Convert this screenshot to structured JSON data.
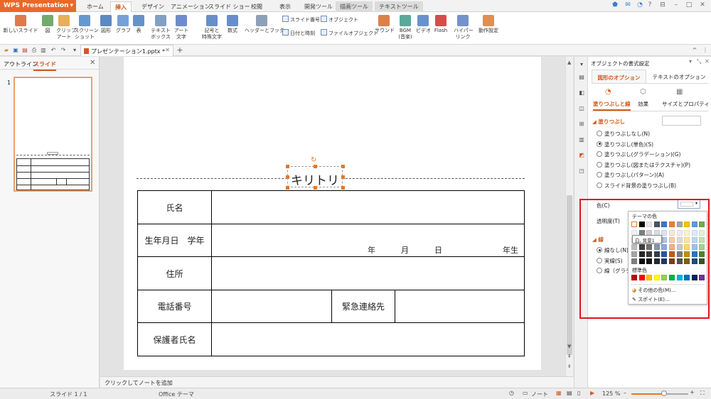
{
  "app": {
    "name": "WPS Presentation",
    "menu_arrow": "▾"
  },
  "menu_tabs": [
    "ホーム",
    "挿入",
    "デザイン",
    "アニメーション",
    "スライド ショー",
    "校閲",
    "表示",
    "開発ツール",
    "描画ツール",
    "テキストツール"
  ],
  "active_tab": "挿入",
  "ribbon": {
    "big_buttons": [
      {
        "label1": "新しいスライド",
        "label2": "",
        "icon": "new-slide-icon",
        "color": "#d9632a"
      },
      {
        "label1": "図",
        "label2": "",
        "icon": "picture-icon",
        "color": "#5b9b52"
      },
      {
        "label1": "クリップ",
        "label2": "アート",
        "icon": "clipart-icon",
        "color": "#e3a23a"
      },
      {
        "label1": "スクリーン",
        "label2": "ショット",
        "icon": "screenshot-icon",
        "color": "#4a87c5"
      },
      {
        "label1": "図形",
        "label2": "",
        "icon": "shapes-icon",
        "color": "#3f73b8"
      },
      {
        "label1": "グラフ",
        "label2": "",
        "icon": "chart-icon",
        "color": "#5f8fd0"
      },
      {
        "label1": "表",
        "label2": "",
        "icon": "table-icon",
        "color": "#4b7fc0"
      },
      {
        "label1": "テキスト",
        "label2": "ボックス",
        "icon": "textbox-icon",
        "color": "#6c8fb8"
      },
      {
        "label1": "アート",
        "label2": "文字",
        "icon": "wordart-icon",
        "color": "#5577c4"
      },
      {
        "label1": "記号と",
        "label2": "特殊文字",
        "icon": "symbol-icon",
        "color": "#4e7ac0"
      },
      {
        "label1": "数式",
        "label2": "",
        "icon": "equation-icon",
        "color": "#4e7ac0"
      },
      {
        "label1": "ヘッダーとフッター",
        "label2": "",
        "icon": "header-footer-icon",
        "color": "#7a8fa8"
      },
      {
        "label1": "サウンド",
        "label2": "",
        "icon": "sound-icon",
        "color": "#d66a2c"
      },
      {
        "label1": "BGM",
        "label2": "(音楽)",
        "icon": "bgm-icon",
        "color": "#3d9a8a"
      },
      {
        "label1": "ビデオ",
        "label2": "",
        "icon": "video-icon",
        "color": "#4f7fc4"
      },
      {
        "label1": "Flash",
        "label2": "",
        "icon": "flash-icon",
        "color": "#d12b2b"
      },
      {
        "label1": "ハイパー",
        "label2": "リンク",
        "icon": "hyperlink-icon",
        "color": "#5b7fbf"
      },
      {
        "label1": "動作設定",
        "label2": "",
        "icon": "action-icon",
        "color": "#e07a2c"
      }
    ],
    "small_buttons": [
      "スライド番号",
      "日付と時刻",
      "オブジェクト",
      "ファイルオブジェクト"
    ]
  },
  "document_tab": {
    "name": "プレゼンテーション1.pptx *"
  },
  "left_panel": {
    "tab_outline": "アウトライン",
    "tab_slides": "スライド",
    "slide_number": "1"
  },
  "slide": {
    "cut_label": "キリトリ",
    "rows": [
      {
        "label": "氏名"
      },
      {
        "label": "生年月日　学年",
        "year": "年",
        "month": "月",
        "day": "日",
        "grade": "年生"
      },
      {
        "label": "住所"
      },
      {
        "label": "電話番号",
        "emergency": "緊急連絡先"
      },
      {
        "label": "保護者氏名"
      }
    ]
  },
  "notes_placeholder": "クリックしてノートを追加",
  "status": {
    "slide": "スライド 1 / 1",
    "theme": "Office テーマ",
    "notes": "ノート",
    "zoom": "125 %"
  },
  "task_pane": {
    "title": "オブジェクトの書式設定",
    "tabs": [
      "図形のオプション",
      "テキストのオプション"
    ],
    "subtabs": [
      "塗りつぶしと線",
      "効果",
      "サイズとプロパティ"
    ],
    "fill_section": "塗りつぶし",
    "fill_options": [
      "塗りつぶしなし(N)",
      "塗りつぶし(単色)(S)",
      "塗りつぶし(グラデーション)(G)",
      "塗りつぶし(図またはテクスチャ)(P)",
      "塗りつぶし(パターン)(A)",
      "スライド背景の塗りつぶし(B)"
    ],
    "fill_selected": 1,
    "color_label": "色(C)",
    "transparency_label": "透明度(T)",
    "line_section": "線",
    "line_options": [
      "線なし(N)",
      "実線(S)",
      "線（グラデ"
    ],
    "line_selected": 0
  },
  "color_picker": {
    "theme_label": "テーマの色",
    "tooltip": "白, 背景1",
    "standard_label": "標準色",
    "more_colors": "その他の色(M)...",
    "eyedropper": "スポイト(E)...",
    "theme_top": [
      "#ffffff",
      "#000000",
      "#e7e6e6",
      "#44546a",
      "#4472c4",
      "#ed7d31",
      "#a5a5a5",
      "#ffc000",
      "#5b9bd5",
      "#70ad47"
    ],
    "theme_shades": [
      [
        "#f2f2f2",
        "#7f7f7f",
        "#d0cece",
        "#d6dce4",
        "#d9e2f3",
        "#fbe5d5",
        "#ededed",
        "#fff2cc",
        "#deebf6",
        "#e2efd9"
      ],
      [
        "#d8d8d8",
        "#595959",
        "#aeabab",
        "#adb9ca",
        "#b4c6e7",
        "#f7cbac",
        "#dbdbdb",
        "#fee599",
        "#bdd7ee",
        "#c5e0b3"
      ],
      [
        "#bfbfbf",
        "#3f3f3f",
        "#757070",
        "#8496b0",
        "#8eaadb",
        "#f4b183",
        "#c9c9c9",
        "#ffd965",
        "#9dc3e6",
        "#a8d08d"
      ],
      [
        "#a5a5a5",
        "#262626",
        "#3a3838",
        "#323f4f",
        "#2f5496",
        "#c55a11",
        "#7b7b7b",
        "#bf9000",
        "#2e75b5",
        "#538135"
      ],
      [
        "#7f7f7f",
        "#0c0c0c",
        "#171616",
        "#222a35",
        "#1f3864",
        "#833c0b",
        "#525252",
        "#7f6000",
        "#1e4e79",
        "#375623"
      ]
    ],
    "standard": [
      "#c00000",
      "#ff0000",
      "#ffc000",
      "#ffff00",
      "#92d050",
      "#00b050",
      "#00b0f0",
      "#0070c0",
      "#002060",
      "#7030a0"
    ]
  },
  "accent_color": "#d25a1c",
  "highlight_color": "#e0141c"
}
